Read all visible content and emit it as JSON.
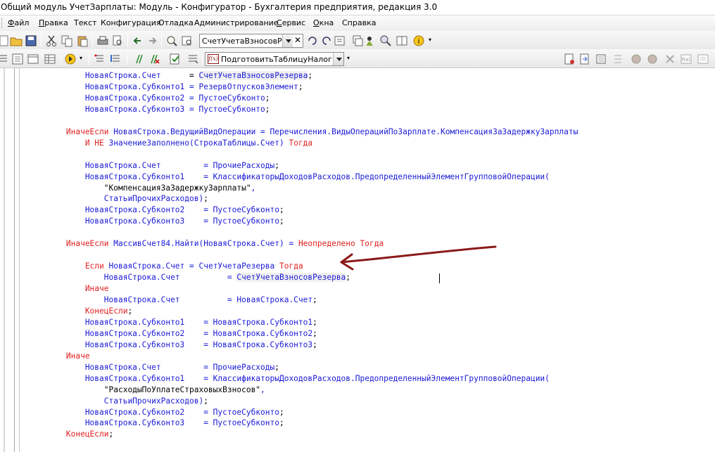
{
  "window": {
    "title": "Общий модуль УчетЗарплаты: Модуль - Конфигуратор - Бухгалтерия предприятия, редакция 3.0"
  },
  "menu": [
    {
      "label": "Файл",
      "underline": "Ф",
      "rest": "айл"
    },
    {
      "label": "Правка",
      "underline": "П",
      "rest": "равка"
    },
    {
      "label": "Текст"
    },
    {
      "label": "Конфигурация"
    },
    {
      "label": "Отладка"
    },
    {
      "label": "Администрирование"
    },
    {
      "label": "Сервис",
      "underline": "С",
      "rest": "ервис"
    },
    {
      "label": "Окна",
      "underline": "О",
      "rest": "кна"
    },
    {
      "label": "Справка"
    }
  ],
  "toolbar1": {
    "search_value": "СчетУчетаВзносовРез"
  },
  "toolbar2": {
    "procedure_value": "ПодготовитьТаблицуНалоговВз"
  },
  "code_lines": [
    [
      [
        "i",
        "            НоваяСтрока.Счет      "
      ],
      [
        "s",
        "= "
      ],
      [
        "i",
        "СчетУчетаВзносовРезерва"
      ],
      [
        "s",
        ";"
      ]
    ],
    [
      [
        "i",
        "            НоваяСтрока.Субконто1 = РезервОтпусковЭлемент"
      ],
      [
        "s",
        ";"
      ]
    ],
    [
      [
        "i",
        "            НоваяСтрока.Субконто2 = ПустоеСубконто"
      ],
      [
        "s",
        ";"
      ]
    ],
    [
      [
        "i",
        "            НоваяСтрока.Субконто3 = ПустоеСубконто"
      ],
      [
        "s",
        ";"
      ]
    ],
    [
      [
        "s",
        ""
      ]
    ],
    [
      [
        "k",
        "        ИначеЕсли "
      ],
      [
        "i",
        "НоваяСтрока.ВедущийВидОперации = Перечисления.ВидыОперацийПоЗарплате.КомпенсацияЗаЗадержкуЗарплаты"
      ]
    ],
    [
      [
        "k",
        "            И НЕ "
      ],
      [
        "i",
        "ЗначениеЗаполнено(СтрокаТаблицы.Счет) "
      ],
      [
        "k",
        "Тогда"
      ]
    ],
    [
      [
        "s",
        ""
      ]
    ],
    [
      [
        "i",
        "            НоваяСтрока.Счет         = ПрочиеРасходы"
      ],
      [
        "s",
        ";"
      ]
    ],
    [
      [
        "i",
        "            НоваяСтрока.Субконто1    = КлассификаторыДоходовРасходов.ПредопределенныйЭлементГрупповойОперации("
      ]
    ],
    [
      [
        "s",
        "                \"КомпенсацияЗаЗадержкуЗарплаты\""
      ],
      [
        "i",
        ","
      ]
    ],
    [
      [
        "i",
        "                СтатьиПрочихРасходов)"
      ],
      [
        "s",
        ";"
      ]
    ],
    [
      [
        "i",
        "            НоваяСтрока.Субконто2    = ПустоеСубконто"
      ],
      [
        "s",
        ";"
      ]
    ],
    [
      [
        "i",
        "            НоваяСтрока.Субконто3    = ПустоеСубконто"
      ],
      [
        "s",
        ";"
      ]
    ],
    [
      [
        "s",
        ""
      ]
    ],
    [
      [
        "k",
        "        ИначеЕсли "
      ],
      [
        "i",
        "МассивСчет84.Найти(НоваяСтрока.Счет) = "
      ],
      [
        "k",
        "Неопределено Тогда"
      ]
    ],
    [
      [
        "s",
        ""
      ]
    ],
    [
      [
        "k",
        "            Если "
      ],
      [
        "i",
        "НоваяСтрока.Счет = СчетУчетаРезерва "
      ],
      [
        "k",
        "Тогда"
      ]
    ],
    [
      [
        "i",
        "                НоваяСтрока.Счет          = "
      ],
      [
        "i",
        "СчетУчетаВзносовРезерва"
      ],
      [
        "s",
        ";"
      ]
    ],
    [
      [
        "k",
        "            Иначе"
      ]
    ],
    [
      [
        "i",
        "                НоваяСтрока.Счет          = НоваяСтрока.Счет"
      ],
      [
        "s",
        ";"
      ]
    ],
    [
      [
        "k",
        "            КонецЕсли"
      ],
      [
        "s",
        ";"
      ]
    ],
    [
      [
        "i",
        "            НоваяСтрока.Субконто1    = НоваяСтрока.Субконто1"
      ],
      [
        "s",
        ";"
      ]
    ],
    [
      [
        "i",
        "            НоваяСтрока.Субконто2    = НоваяСтрока.Субконто2"
      ],
      [
        "s",
        ";"
      ]
    ],
    [
      [
        "i",
        "            НоваяСтрока.Субконто3    = НоваяСтрока.Субконто3"
      ],
      [
        "s",
        ";"
      ]
    ],
    [
      [
        "k",
        "        Иначе"
      ]
    ],
    [
      [
        "i",
        "            НоваяСтрока.Счет         = ПрочиеРасходы"
      ],
      [
        "s",
        ";"
      ]
    ],
    [
      [
        "i",
        "            НоваяСтрока.Субконто1    = КлассификаторыДоходовРасходов.ПредопределенныйЭлементГрупповойОперации("
      ]
    ],
    [
      [
        "s",
        "                \"РасходыПоУплатеСтраховыхВзносов\""
      ],
      [
        "i",
        ","
      ]
    ],
    [
      [
        "i",
        "                СтатьиПрочихРасходов)"
      ],
      [
        "s",
        ";"
      ]
    ],
    [
      [
        "i",
        "            НоваяСтрока.Субконто2    = ПустоеСубконто"
      ],
      [
        "s",
        ";"
      ]
    ],
    [
      [
        "i",
        "            НоваяСтрока.Субконто3    = ПустоеСубконто"
      ],
      [
        "s",
        ";"
      ]
    ],
    [
      [
        "k",
        "        КонецЕсли"
      ],
      [
        "s",
        ";"
      ]
    ]
  ],
  "colors": {
    "keyword": "#e02020",
    "identifier": "#1a1ad6",
    "annotation_arrow": "#8b1a1a"
  }
}
